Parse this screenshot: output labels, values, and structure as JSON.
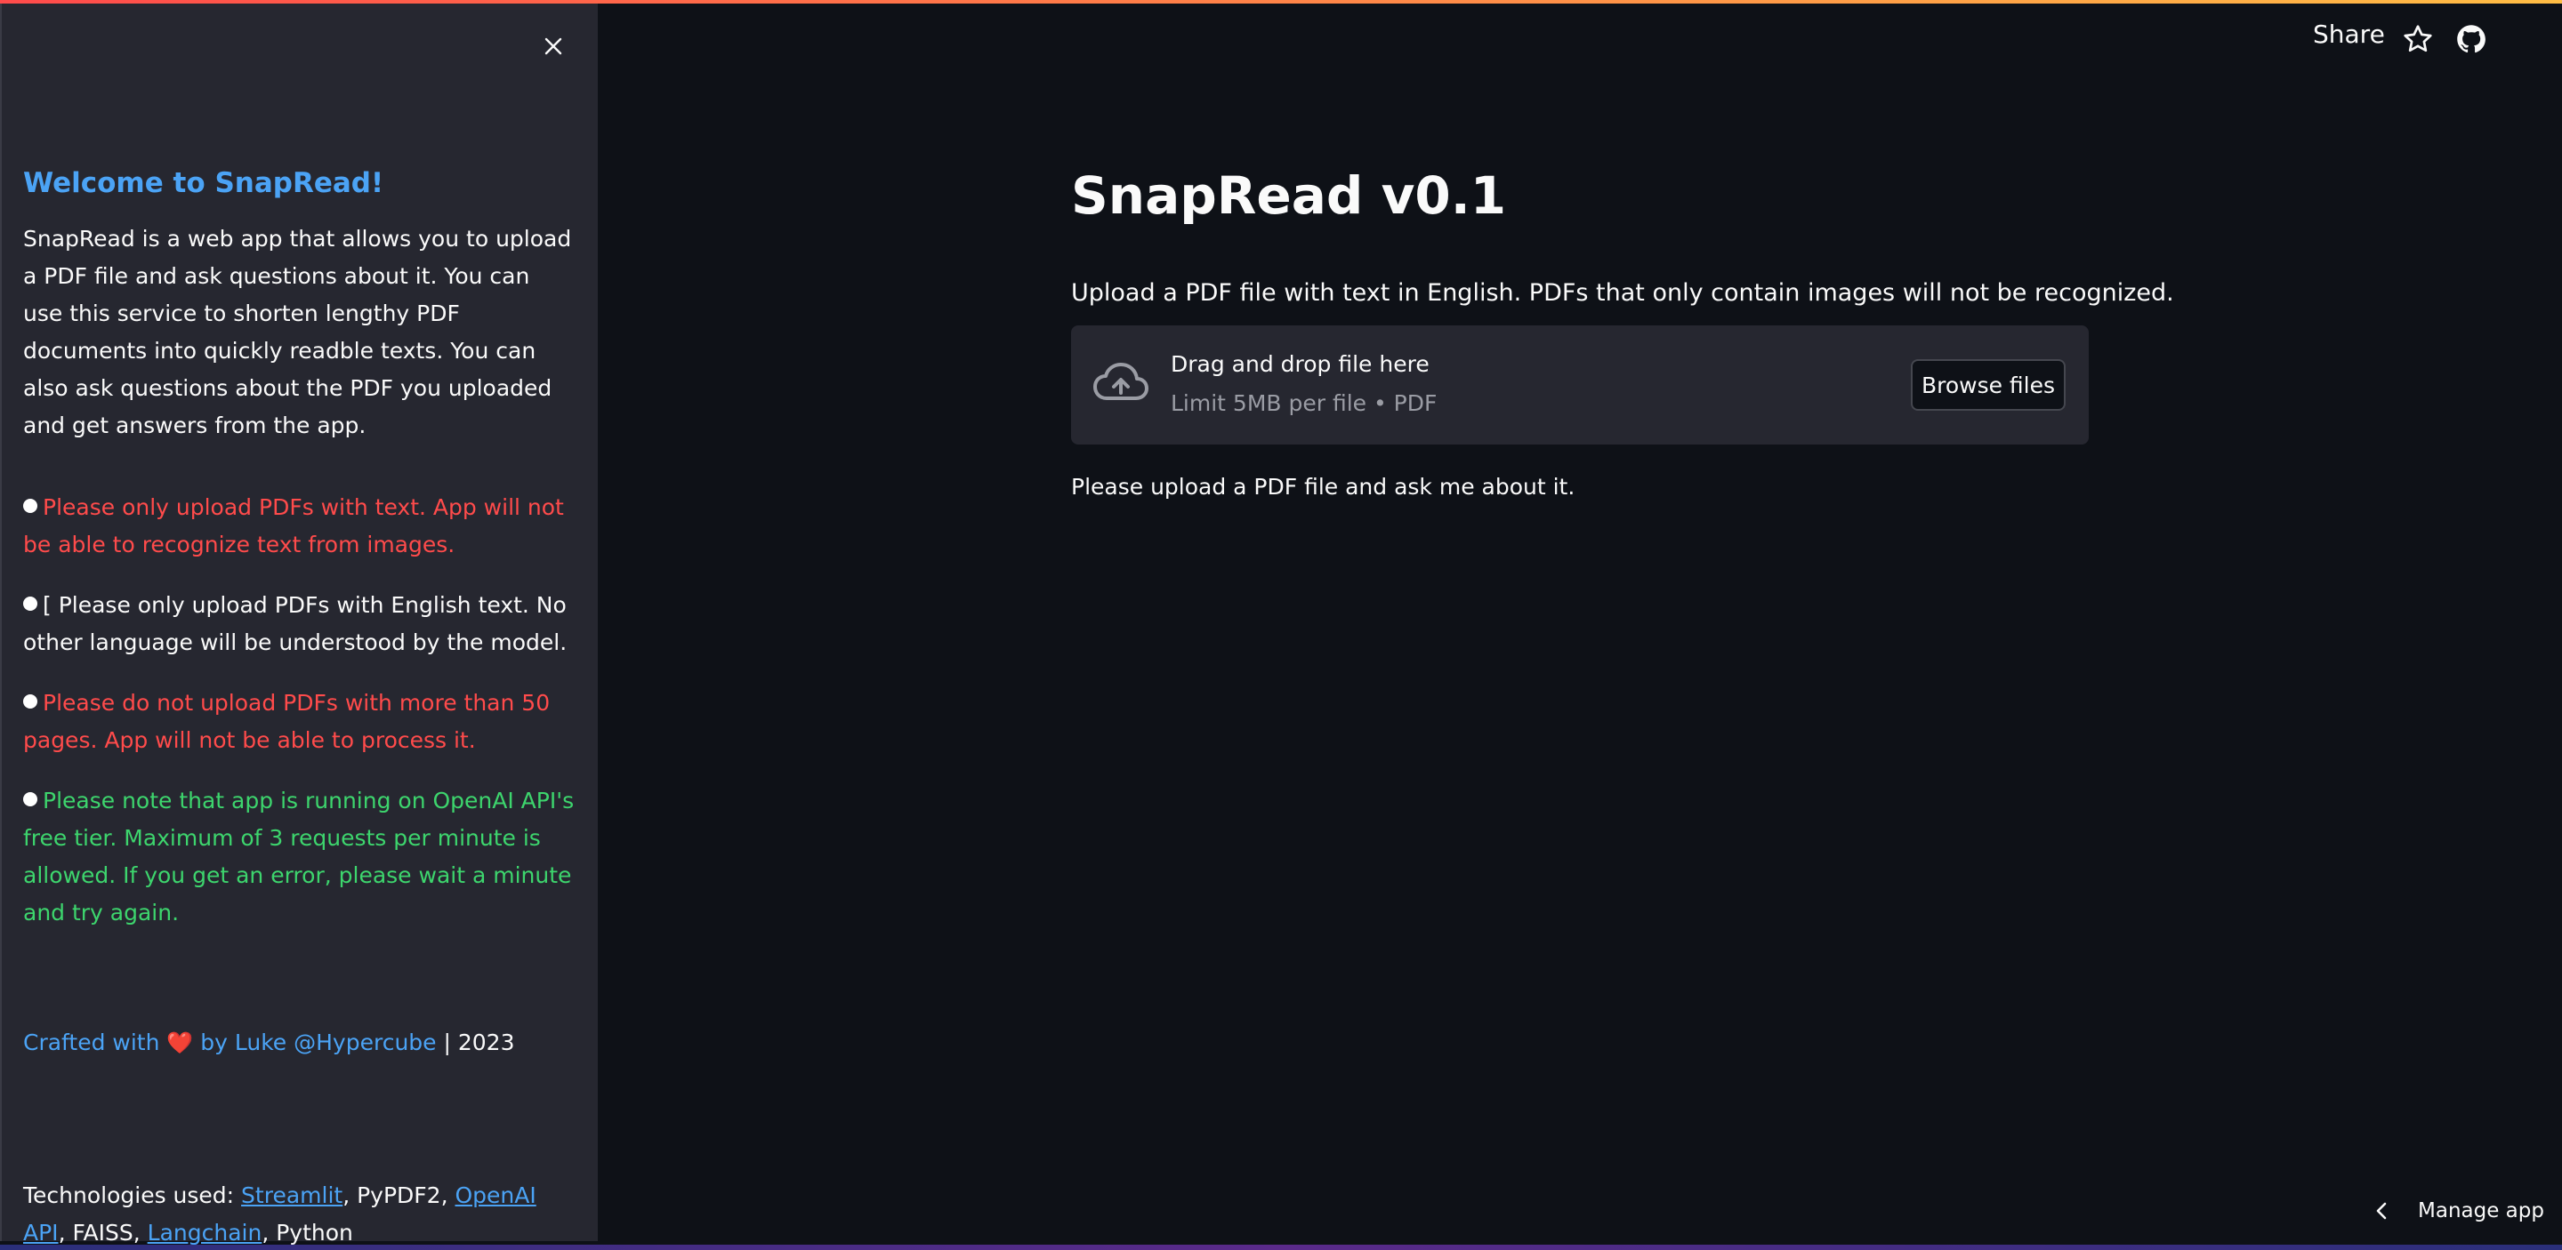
{
  "sidebar": {
    "welcome_title": "Welcome to SnapRead!",
    "intro": "SnapRead is a web app that allows you to upload a PDF file and ask questions about it. You can use this service to shorten lengthy PDF documents into quickly readble texts. You can also ask questions about the PDF you uploaded and get answers from the app.",
    "bullets": [
      {
        "text": "Please only upload PDFs with text. App will not be able to recognize text from images.",
        "color": "#ff4b4b"
      },
      {
        "text": "[ Please only upload PDFs with English text. No other language will be understood by the model.",
        "color": "#fafafa"
      },
      {
        "text": "Please do not upload PDFs with more than 50 pages. App will not be able to process it.",
        "color": "#ff4b4b"
      },
      {
        "text": "Please note that app is running on OpenAI API's free tier. Maximum of 3 requests per minute is allowed. If you get an error, please wait a minute and try again.",
        "color": "#3dd56d"
      }
    ],
    "crafted": {
      "prefix": "Crafted with",
      "heart": "❤️",
      "by": "by Luke @Hypercube",
      "suffix": "| 2023"
    },
    "tech": {
      "prefix": "Technologies used:",
      "streamlit": "Streamlit",
      "pypdf": ", PyPDF2,",
      "openai": "OpenAI API",
      "faiss": ", FAISS,",
      "langchain": "Langchain",
      "python": ", Python"
    }
  },
  "header": {
    "share_label": "Share",
    "star_icon": "star-icon",
    "github_icon": "github-icon"
  },
  "main": {
    "title": "SnapRead v0.1",
    "upload_label": "Upload a PDF file with text in English. PDFs that only contain images will not be recognized.",
    "dropzone": {
      "title": "Drag and drop file here",
      "limit": "Limit 5MB per file • PDF",
      "browse_label": "Browse files"
    },
    "prompt": "Please upload a PDF file and ask me about it."
  },
  "footer": {
    "manage_app_label": "Manage app"
  },
  "colors": {
    "background": "#0e1117",
    "sidebar": "#262730",
    "accent_blue": "#4ba3f5",
    "red": "#ff4b4b",
    "green": "#3dd56d"
  }
}
